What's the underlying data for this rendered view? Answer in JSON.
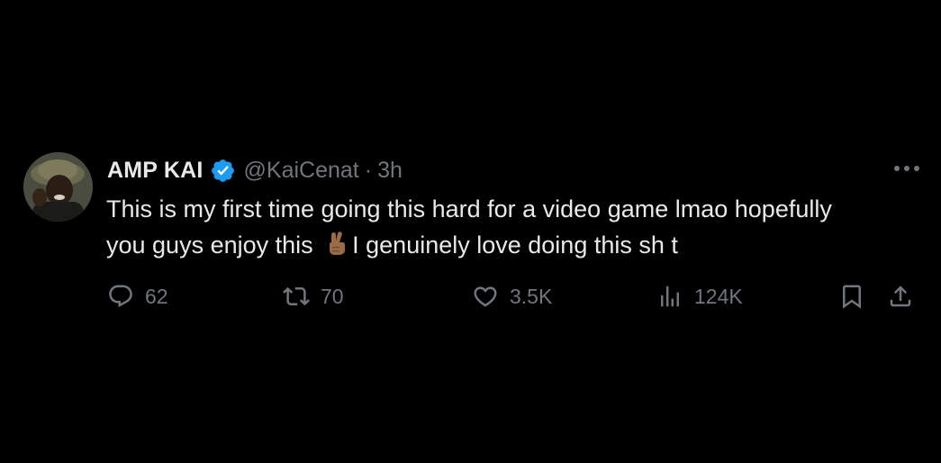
{
  "tweet": {
    "author_name": "AMP KAI",
    "handle": "@KaiCenat",
    "separator": "·",
    "time": "3h",
    "text_line1": "This is my first time going this hard for a video game lmao hopefully",
    "text_line2_before": "you guys enjoy this",
    "text_line2_after": "I genuinely love doing this sh t",
    "emoji": "crossed-fingers-emoji"
  },
  "actions": {
    "replies": "62",
    "retweets": "70",
    "likes": "3.5K",
    "views": "124K"
  },
  "icons": {
    "verified": "verified-badge-icon",
    "more": "more-options-icon",
    "reply": "reply-icon",
    "retweet": "retweet-icon",
    "like": "heart-icon",
    "views": "views-chart-icon",
    "bookmark": "bookmark-icon",
    "share": "share-icon"
  },
  "colors": {
    "background": "#000000",
    "primary_text": "#e7e9ea",
    "secondary_text": "#71767b",
    "verified_blue": "#1d9bf0"
  }
}
